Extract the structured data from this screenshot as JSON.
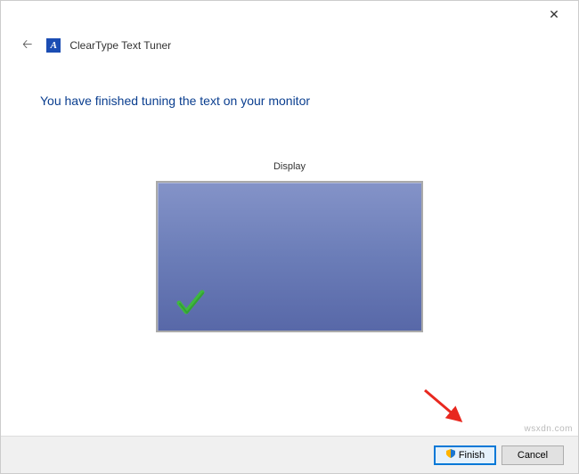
{
  "window": {
    "app_icon_letter": "A",
    "title": "ClearType Text Tuner"
  },
  "content": {
    "heading": "You have finished tuning the text on your monitor",
    "display_label": "Display"
  },
  "footer": {
    "finish_label": "Finish",
    "cancel_label": "Cancel"
  },
  "watermark": "wsxdn.com"
}
